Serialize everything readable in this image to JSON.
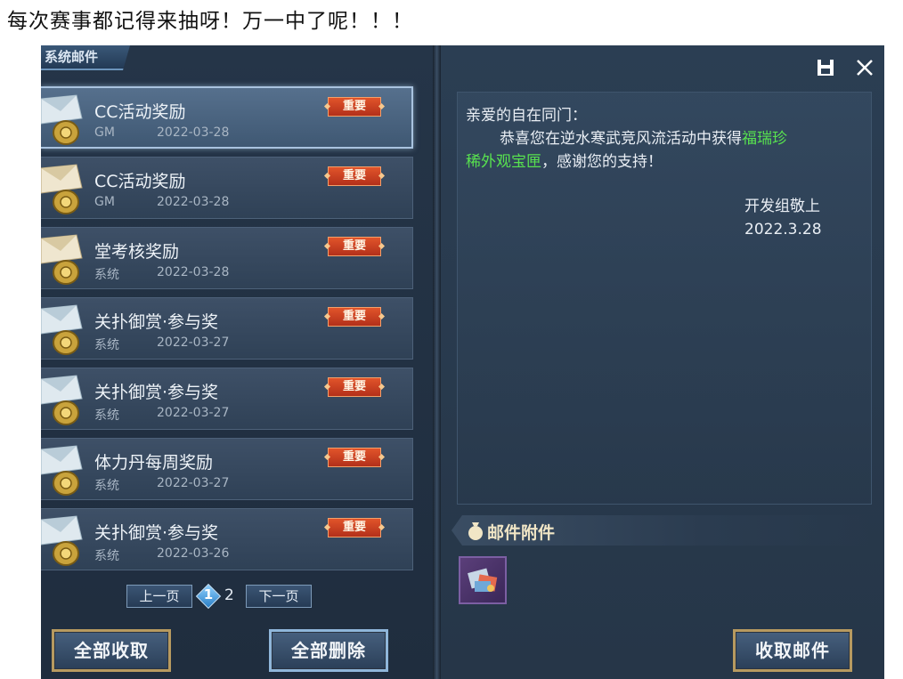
{
  "caption": "每次赛事都记得来抽呀！万一中了呢！！！",
  "panel": {
    "tab_title": "系统邮件"
  },
  "mails": [
    {
      "title": "CC活动奖励",
      "sender": "GM",
      "date": "2022-03-28",
      "badge": "重要",
      "selected": true
    },
    {
      "title": "CC活动奖励",
      "sender": "GM",
      "date": "2022-03-28",
      "badge": "重要",
      "selected": false
    },
    {
      "title": "堂考核奖励",
      "sender": "系统",
      "date": "2022-03-28",
      "badge": "重要",
      "selected": false
    },
    {
      "title": "关扑御赏·参与奖",
      "sender": "系统",
      "date": "2022-03-27",
      "badge": "重要",
      "selected": false
    },
    {
      "title": "关扑御赏·参与奖",
      "sender": "系统",
      "date": "2022-03-27",
      "badge": "重要",
      "selected": false
    },
    {
      "title": "体力丹每周奖励",
      "sender": "系统",
      "date": "2022-03-27",
      "badge": "重要",
      "selected": false
    },
    {
      "title": "关扑御赏·参与奖",
      "sender": "系统",
      "date": "2022-03-26",
      "badge": "重要",
      "selected": false
    }
  ],
  "pager": {
    "prev_label": "上一页",
    "current_page": "1",
    "next_page": "2",
    "next_label": "下一页"
  },
  "actions": {
    "collect_all": "全部收取",
    "delete_all": "全部删除",
    "collect_mail": "收取邮件"
  },
  "letter": {
    "greeting": "亲爱的自在同门：",
    "body_line1_prefix": "恭喜您在逆水寒武竞风流活动中获得",
    "reward_line1": "福瑞珍",
    "reward_line2": "稀外观宝匣",
    "body_line2_suffix": "，感谢您的支持！",
    "signature": "开发组敬上",
    "sign_date": "2022.3.28"
  },
  "attachments": {
    "title": "邮件附件"
  },
  "window": {
    "save_icon": "save-icon",
    "close_icon": "close-icon"
  },
  "colors": {
    "highlight": "#58e24f",
    "badge": "#d0401f",
    "button_gold_border": "#b79a60"
  }
}
